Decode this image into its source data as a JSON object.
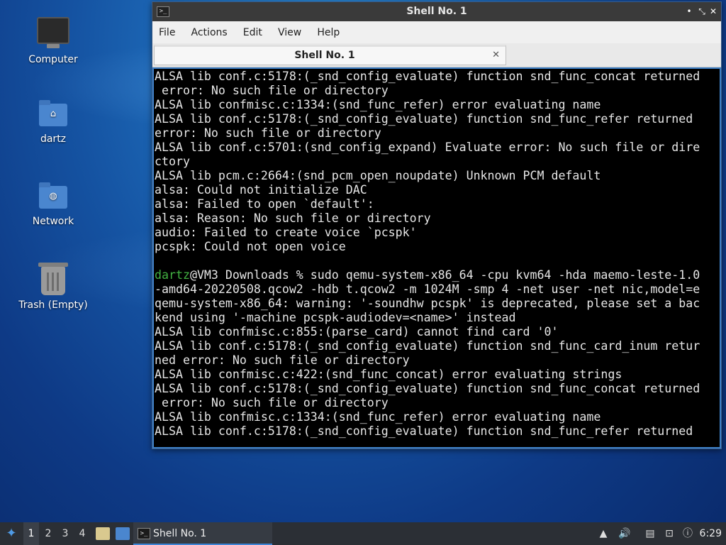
{
  "desktop": {
    "icons": [
      {
        "label": "Computer",
        "icon": "computer-icon"
      },
      {
        "label": "dartz",
        "icon": "home-folder-icon"
      },
      {
        "label": "Network",
        "icon": "network-folder-icon"
      },
      {
        "label": "Trash (Empty)",
        "icon": "trash-icon"
      }
    ]
  },
  "window": {
    "title": "Shell No. 1",
    "controls": {
      "minimize": "•",
      "maximize": "⤡",
      "close": "✕"
    },
    "menu": [
      "File",
      "Actions",
      "Edit",
      "View",
      "Help"
    ],
    "tab": {
      "label": "Shell No. 1",
      "close": "✕"
    },
    "terminal": {
      "lines_before": [
        "ALSA lib conf.c:5178:(_snd_config_evaluate) function snd_func_concat returned",
        " error: No such file or directory",
        "ALSA lib confmisc.c:1334:(snd_func_refer) error evaluating name",
        "ALSA lib conf.c:5178:(_snd_config_evaluate) function snd_func_refer returned",
        "error: No such file or directory",
        "ALSA lib conf.c:5701:(snd_config_expand) Evaluate error: No such file or dire",
        "ctory",
        "ALSA lib pcm.c:2664:(snd_pcm_open_noupdate) Unknown PCM default",
        "alsa: Could not initialize DAC",
        "alsa: Failed to open `default':",
        "alsa: Reason: No such file or directory",
        "audio: Failed to create voice `pcspk'",
        "pcspk: Could not open voice",
        ""
      ],
      "prompt_user": "dartz",
      "prompt_rest": "@VM3 Downloads % sudo qemu-system-x86_64 -cpu kvm64 -hda maemo-leste-1.0",
      "lines_after": [
        "-amd64-20220508.qcow2 -hdb t.qcow2 -m 1024M -smp 4 -net user -net nic,model=e",
        "qemu-system-x86_64: warning: '-soundhw pcspk' is deprecated, please set a bac",
        "kend using '-machine pcspk-audiodev=<name>' instead",
        "ALSA lib confmisc.c:855:(parse_card) cannot find card '0'",
        "ALSA lib conf.c:5178:(_snd_config_evaluate) function snd_func_card_inum retur",
        "ned error: No such file or directory",
        "ALSA lib confmisc.c:422:(snd_func_concat) error evaluating strings",
        "ALSA lib conf.c:5178:(_snd_config_evaluate) function snd_func_concat returned",
        " error: No such file or directory",
        "ALSA lib confmisc.c:1334:(snd_func_refer) error evaluating name",
        "ALSA lib conf.c:5178:(_snd_config_evaluate) function snd_func_refer returned"
      ]
    }
  },
  "taskbar": {
    "workspaces": [
      "1",
      "2",
      "3",
      "4"
    ],
    "active_workspace": "1",
    "task_label": "Shell No. 1",
    "clock": "6:29",
    "tray_icons": [
      "upload-icon",
      "volume-icon",
      "clipboard-icon",
      "network-icon",
      "updates-icon"
    ]
  },
  "colors": {
    "prompt_user": "#42b142",
    "terminal_bg": "#000000",
    "terminal_fg": "#e6e6e6",
    "titlebar_bg": "#3a3a3a",
    "taskbar_bg": "#2b2f35",
    "accent": "#3d7fc6"
  }
}
